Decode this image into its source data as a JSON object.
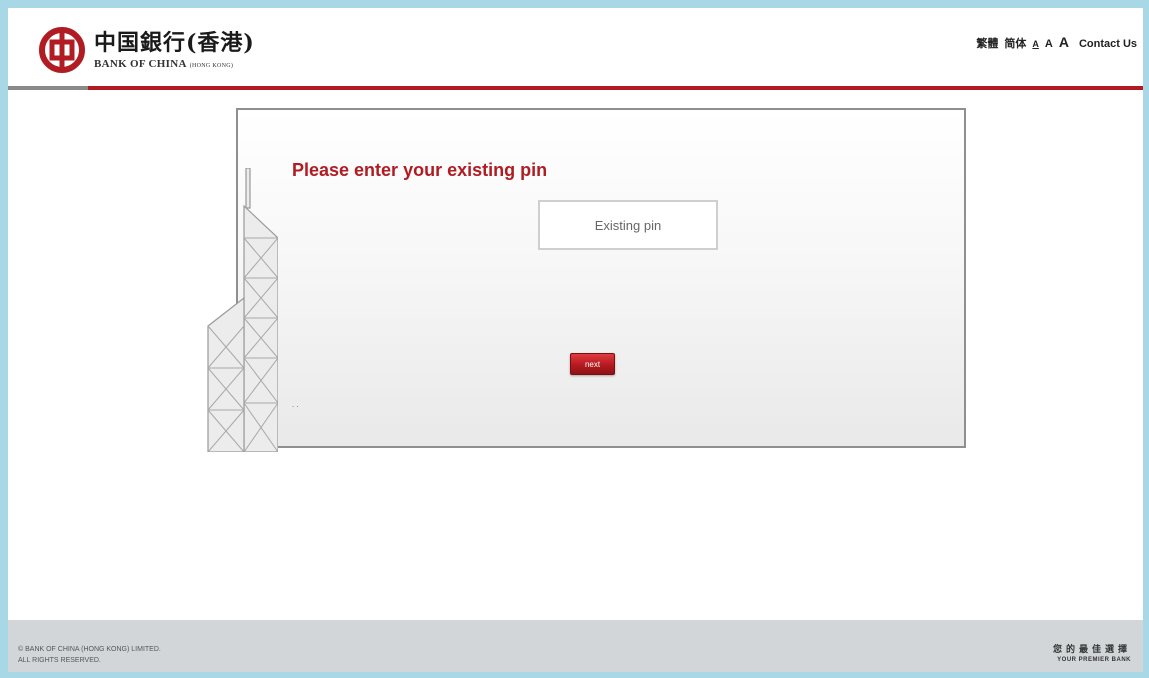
{
  "header": {
    "logo_cn": "中国銀行(香港)",
    "logo_en": "BANK OF CHINA",
    "logo_en_small": "(HONG KONG)",
    "lang_traditional": "繁體",
    "lang_simplified": "简体",
    "font_small": "A",
    "font_medium": "A",
    "font_large": "A",
    "contact": "Contact Us"
  },
  "main": {
    "title": "Please enter your existing pin",
    "pin_placeholder": "Existing pin",
    "next_label": "next",
    "dots": ". ."
  },
  "footer": {
    "copyright_line1": "© BANK OF CHINA (HONG KONG) LIMITED.",
    "copyright_line2": "ALL RIGHTS RESERVED.",
    "slogan_cn": "您的最佳選擇",
    "slogan_en": "YOUR PREMIER BANK"
  },
  "colors": {
    "brand_red": "#b01c22",
    "background": "#a8d8e6",
    "footer": "#d3d6d9"
  },
  "icons": {
    "logo": "boc-logo-icon",
    "tower": "boc-tower-illustration"
  }
}
